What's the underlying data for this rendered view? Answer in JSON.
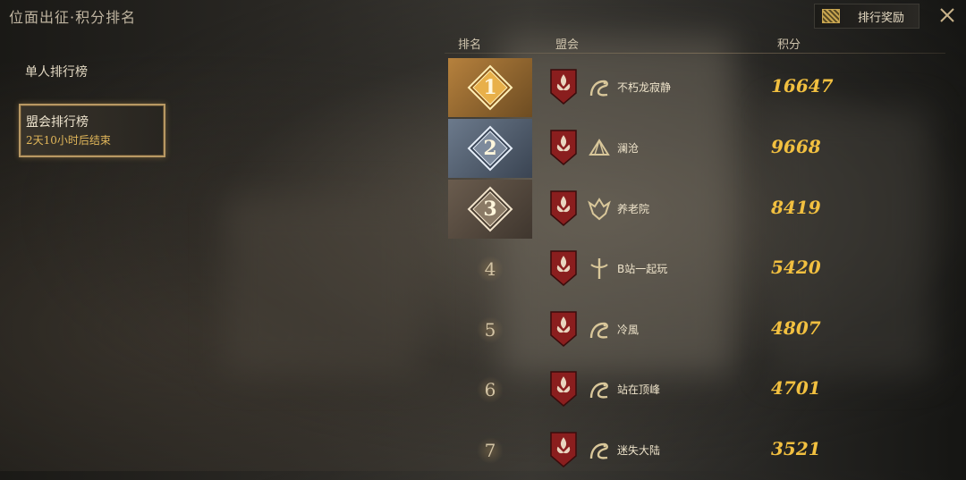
{
  "header": {
    "title": "位面出征·积分排名",
    "reward_button": "排行奖励",
    "close_icon": "close-icon"
  },
  "sidebar": {
    "items": [
      {
        "label": "单人排行榜"
      },
      {
        "label": "盟会排行榜",
        "subtitle": "2天10小时后结束"
      }
    ]
  },
  "table": {
    "columns": [
      "排名",
      "盟会",
      "积分"
    ],
    "rows": [
      {
        "rank": "1",
        "guild": "不朽龙寂静",
        "score": "16647",
        "emblem": "dragon-emblem-icon"
      },
      {
        "rank": "2",
        "guild": "澜沧",
        "score": "9668",
        "emblem": "wing-emblem-icon"
      },
      {
        "rank": "3",
        "guild": "养老院",
        "score": "8419",
        "emblem": "eagle-emblem-icon"
      },
      {
        "rank": "4",
        "guild": "B站一起玩",
        "score": "5420",
        "emblem": "sword-emblem-icon"
      },
      {
        "rank": "5",
        "guild": "冷風",
        "score": "4807",
        "emblem": "dragon-emblem-icon"
      },
      {
        "rank": "6",
        "guild": "站在顶峰",
        "score": "4701",
        "emblem": "dragon-emblem-icon"
      },
      {
        "rank": "7",
        "guild": "迷失大陆",
        "score": "3521",
        "emblem": "dragon-emblem-icon"
      }
    ]
  },
  "colors": {
    "gold": "#f2c040",
    "accent_orange": "#e2b75a",
    "shield_red": "#8a1e1e"
  }
}
